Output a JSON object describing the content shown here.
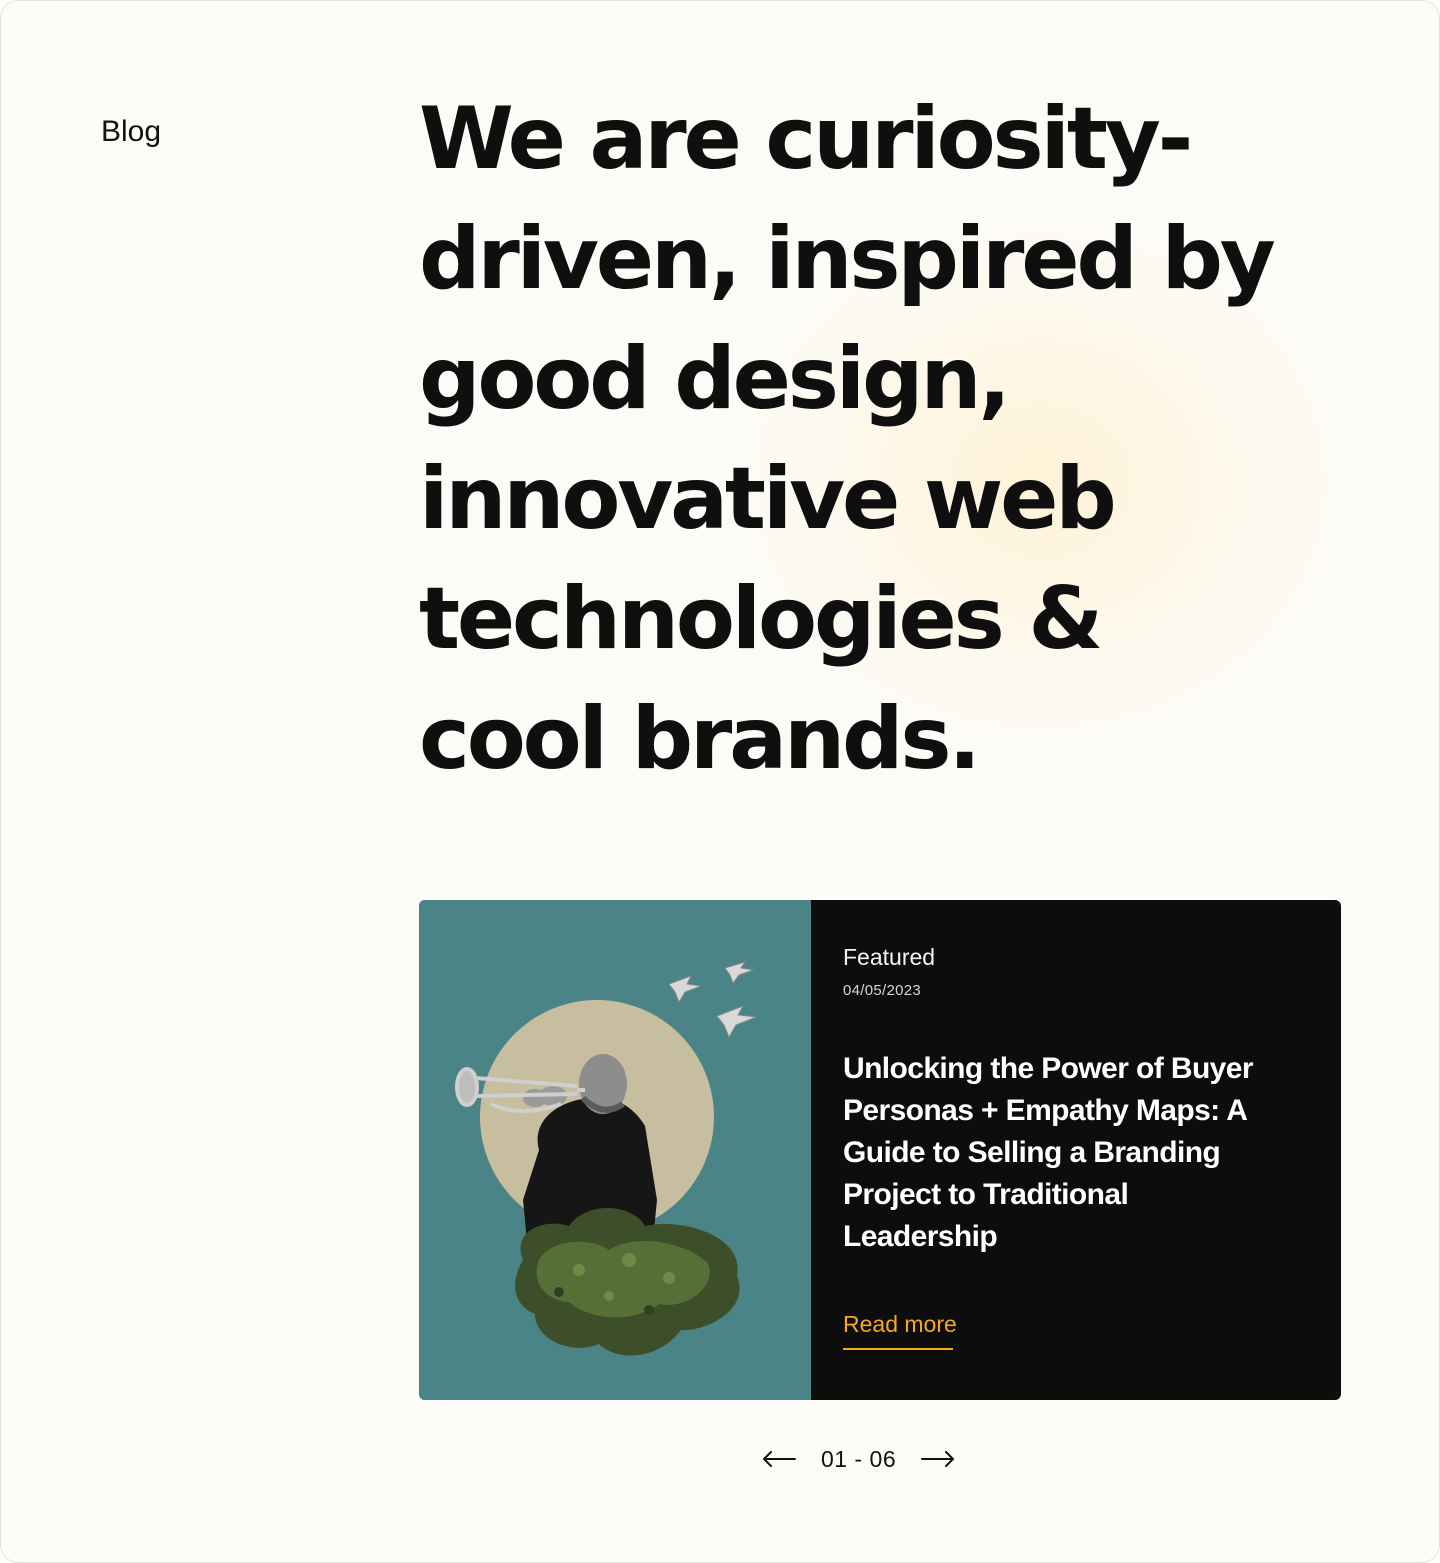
{
  "section": {
    "label": "Blog"
  },
  "hero": {
    "lines": [
      "We are curiosity-",
      "driven, inspired by",
      "good design,",
      "innovative web",
      "technologies &",
      "cool brands."
    ]
  },
  "featured_post": {
    "tag": "Featured",
    "date": "04/05/2023",
    "title": "Unlocking the Power of Buyer Personas + Empathy Maps: A Guide to Selling a Branding Project to Traditional Leadership",
    "read_more_label": "Read more",
    "image_alt": "Collage of a man playing a trumpet emerging from a bush, with paper birds flying",
    "colors": {
      "image_background": "#4a8487",
      "card_background": "#0d0d0d",
      "accent": "#f5a91a"
    }
  },
  "pagination": {
    "label": "01 - 06",
    "prev_icon": "arrow-left-icon",
    "next_icon": "arrow-right-icon"
  }
}
